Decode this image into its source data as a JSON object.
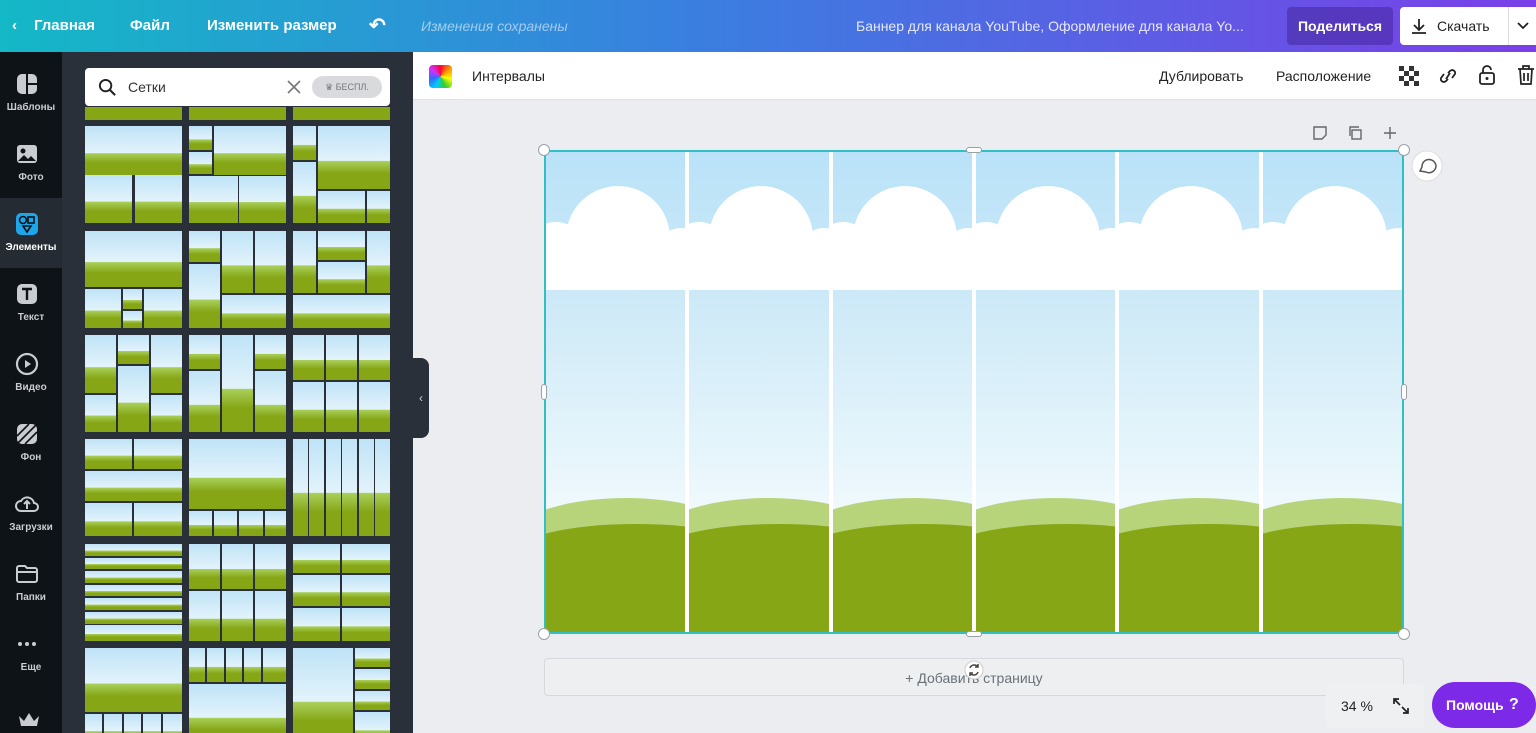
{
  "topbar": {
    "home": "Главная",
    "file": "Файл",
    "resize": "Изменить размер",
    "saved_status": "Изменения сохранены",
    "design_title": "Баннер для канала YouTube, Оформление для канала Yo...",
    "share": "Поделиться",
    "download": "Скачать"
  },
  "rail": [
    {
      "label": "Шаблоны",
      "icon": "templates-icon"
    },
    {
      "label": "Фото",
      "icon": "photo-icon"
    },
    {
      "label": "Элементы",
      "icon": "elements-icon",
      "active": true
    },
    {
      "label": "Текст",
      "icon": "text-icon"
    },
    {
      "label": "Видео",
      "icon": "video-icon"
    },
    {
      "label": "Фон",
      "icon": "background-icon"
    },
    {
      "label": "Загрузки",
      "icon": "uploads-icon"
    },
    {
      "label": "Папки",
      "icon": "folders-icon"
    },
    {
      "label": "Еще",
      "icon": "more-icon"
    }
  ],
  "search": {
    "query": "Сетки",
    "badge": "♛ БЕСПЛ."
  },
  "toolbar": {
    "spacing": "Интервалы",
    "duplicate": "Дублировать",
    "position": "Расположение"
  },
  "canvas": {
    "add_page": "+ Добавить страницу",
    "column_count": 6
  },
  "footer": {
    "zoom": "34 %",
    "help": "Помощь",
    "help_icon": "?"
  },
  "colors": {
    "accent_teal": "#30c0c4",
    "help_purple": "#7d2ae8",
    "grass_dark": "#86a616",
    "grass_light": "#b7d47a",
    "sky": "#b9e2f8"
  }
}
